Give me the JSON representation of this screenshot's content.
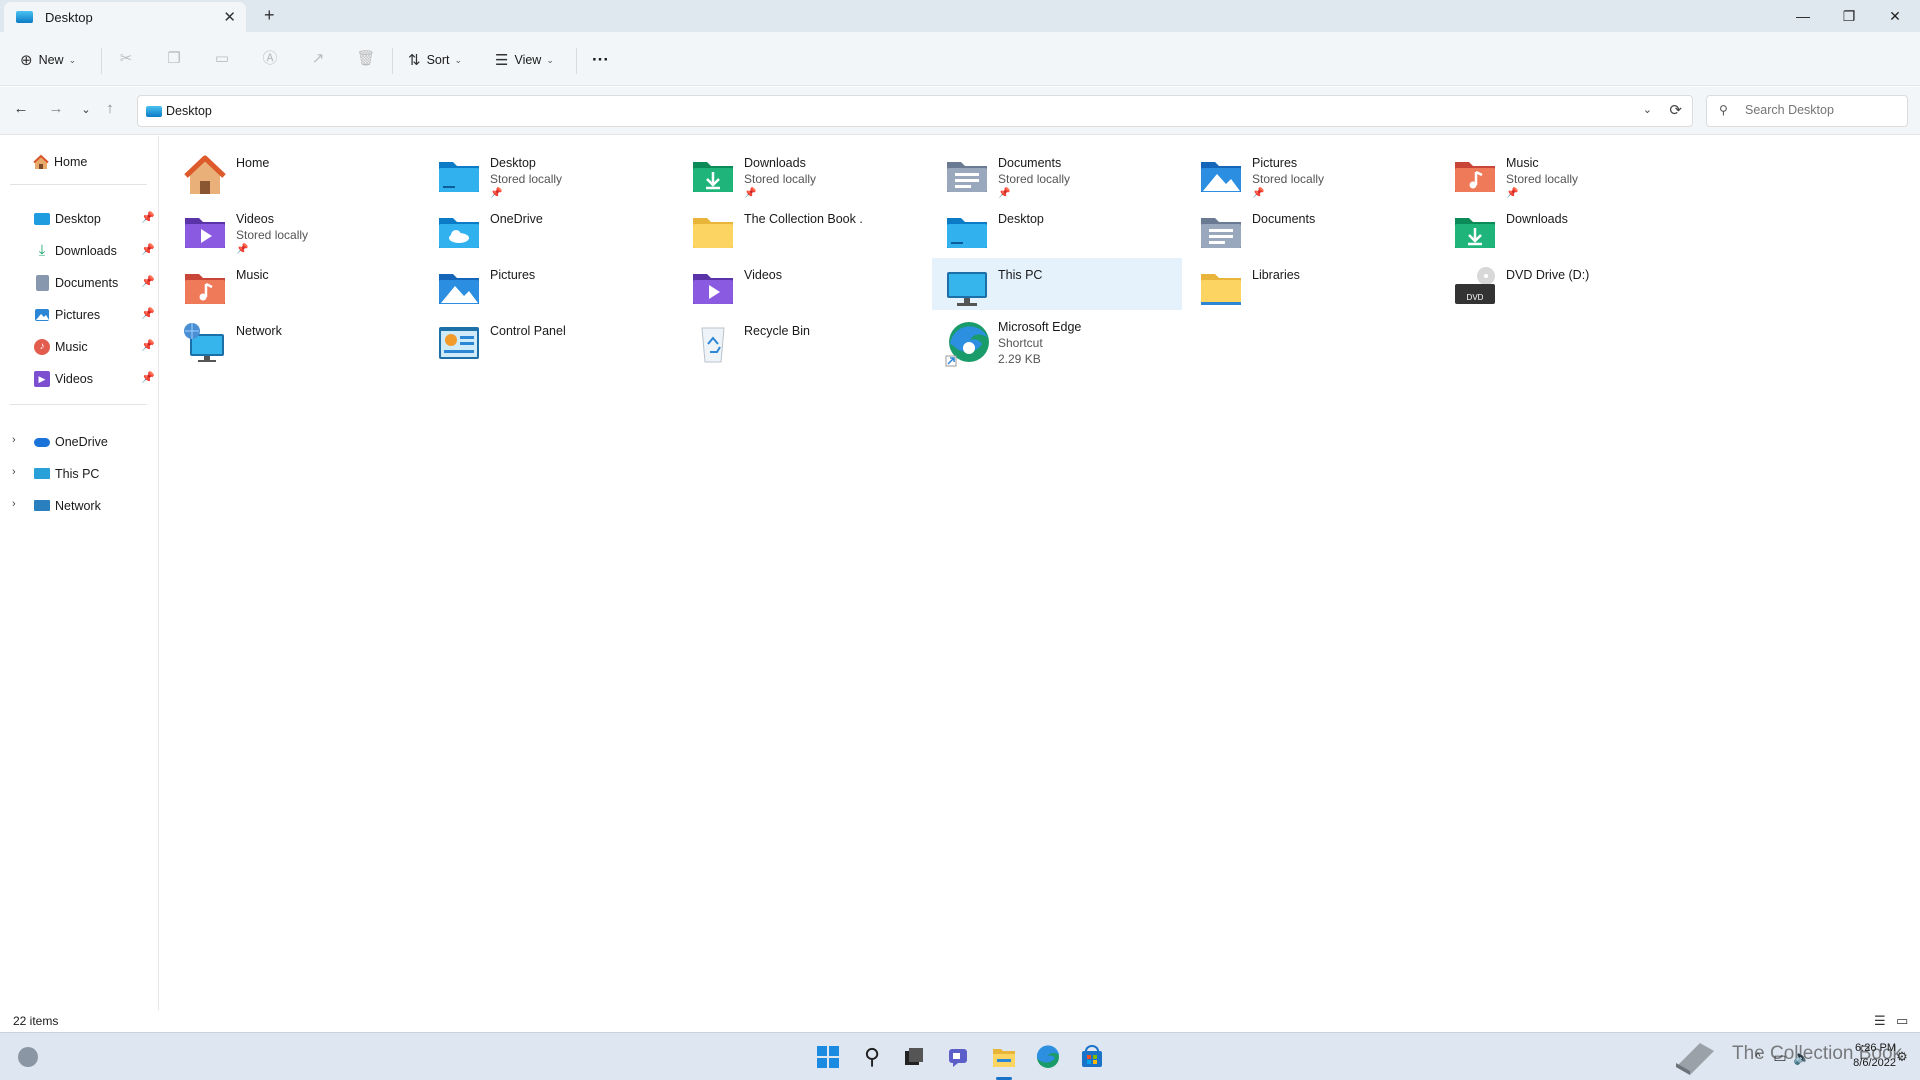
{
  "window": {
    "tab_title": "Desktop",
    "new_tab": "+",
    "minimize": "—",
    "restore": "❐",
    "close": "✕"
  },
  "toolbar": {
    "new_label": "New",
    "sort_label": "Sort",
    "view_label": "View",
    "more_label": "···",
    "disabled_actions": [
      "cut-icon",
      "copy-icon",
      "paste-icon",
      "rename-icon",
      "share-icon",
      "delete-icon"
    ]
  },
  "address": {
    "path": "Desktop",
    "search_placeholder": "Search Desktop"
  },
  "sidebar": {
    "home": "Home",
    "quick_access": [
      {
        "label": "Desktop",
        "icon": "desktop-icon",
        "color": "#1f9be0"
      },
      {
        "label": "Downloads",
        "icon": "downloads-icon",
        "color": "#1aa56c"
      },
      {
        "label": "Documents",
        "icon": "documents-icon",
        "color": "#7a8aa3"
      },
      {
        "label": "Pictures",
        "icon": "pictures-icon",
        "color": "#2b86d6"
      },
      {
        "label": "Music",
        "icon": "music-icon",
        "color": "#e35d4f"
      },
      {
        "label": "Videos",
        "icon": "videos-icon",
        "color": "#7b4fd0"
      }
    ],
    "locations": [
      {
        "label": "OneDrive",
        "icon": "onedrive-icon",
        "color": "#1a73d9"
      },
      {
        "label": "This PC",
        "icon": "this-pc-icon",
        "color": "#2aa0d8"
      },
      {
        "label": "Network",
        "icon": "network-icon",
        "color": "#2a7fbf"
      }
    ]
  },
  "items": [
    {
      "name": "Home",
      "sub": "",
      "sub2": "",
      "pinned": false,
      "icon": "home-icon"
    },
    {
      "name": "Desktop",
      "sub": "Stored locally",
      "sub2": "",
      "pinned": true,
      "icon": "desktop-folder-icon"
    },
    {
      "name": "Downloads",
      "sub": "Stored locally",
      "sub2": "",
      "pinned": true,
      "icon": "downloads-folder-icon"
    },
    {
      "name": "Documents",
      "sub": "Stored locally",
      "sub2": "",
      "pinned": true,
      "icon": "documents-folder-icon"
    },
    {
      "name": "Pictures",
      "sub": "Stored locally",
      "sub2": "",
      "pinned": true,
      "icon": "pictures-folder-icon"
    },
    {
      "name": "Music",
      "sub": "Stored locally",
      "sub2": "",
      "pinned": true,
      "icon": "music-folder-icon"
    },
    {
      "name": "Videos",
      "sub": "Stored locally",
      "sub2": "",
      "pinned": true,
      "icon": "videos-folder-icon"
    },
    {
      "name": "OneDrive",
      "sub": "",
      "sub2": "",
      "pinned": false,
      "icon": "onedrive-folder-icon"
    },
    {
      "name": "The Collection Book .",
      "sub": "",
      "sub2": "",
      "pinned": false,
      "icon": "folder-icon"
    },
    {
      "name": "Desktop",
      "sub": "",
      "sub2": "",
      "pinned": false,
      "icon": "desktop-folder-icon"
    },
    {
      "name": "Documents",
      "sub": "",
      "sub2": "",
      "pinned": false,
      "icon": "documents-folder-icon"
    },
    {
      "name": "Downloads",
      "sub": "",
      "sub2": "",
      "pinned": false,
      "icon": "downloads-folder-icon"
    },
    {
      "name": "Music",
      "sub": "",
      "sub2": "",
      "pinned": false,
      "icon": "music-folder-icon"
    },
    {
      "name": "Pictures",
      "sub": "",
      "sub2": "",
      "pinned": false,
      "icon": "pictures-folder-icon"
    },
    {
      "name": "Videos",
      "sub": "",
      "sub2": "",
      "pinned": false,
      "icon": "videos-folder-icon"
    },
    {
      "name": "This PC",
      "sub": "",
      "sub2": "",
      "pinned": false,
      "icon": "this-pc-icon",
      "selected": true
    },
    {
      "name": "Libraries",
      "sub": "",
      "sub2": "",
      "pinned": false,
      "icon": "libraries-icon"
    },
    {
      "name": "DVD Drive (D:)",
      "sub": "",
      "sub2": "",
      "pinned": false,
      "icon": "dvd-drive-icon"
    },
    {
      "name": "Network",
      "sub": "",
      "sub2": "",
      "pinned": false,
      "icon": "network-icon"
    },
    {
      "name": "Control Panel",
      "sub": "",
      "sub2": "",
      "pinned": false,
      "icon": "control-panel-icon"
    },
    {
      "name": "Recycle Bin",
      "sub": "",
      "sub2": "",
      "pinned": false,
      "icon": "recycle-bin-icon"
    },
    {
      "name": "Microsoft Edge",
      "sub": "Shortcut",
      "sub2": "2.29 KB",
      "pinned": false,
      "icon": "edge-shortcut-icon"
    }
  ],
  "status": {
    "count": "22 items"
  },
  "taskbar": {
    "apps": [
      "start-icon",
      "search-icon",
      "task-view-icon",
      "chat-icon",
      "file-explorer-icon",
      "edge-icon",
      "store-icon"
    ],
    "time": "6:26 PM",
    "date": "8/6/2022",
    "watermark": "The Collection Book"
  }
}
